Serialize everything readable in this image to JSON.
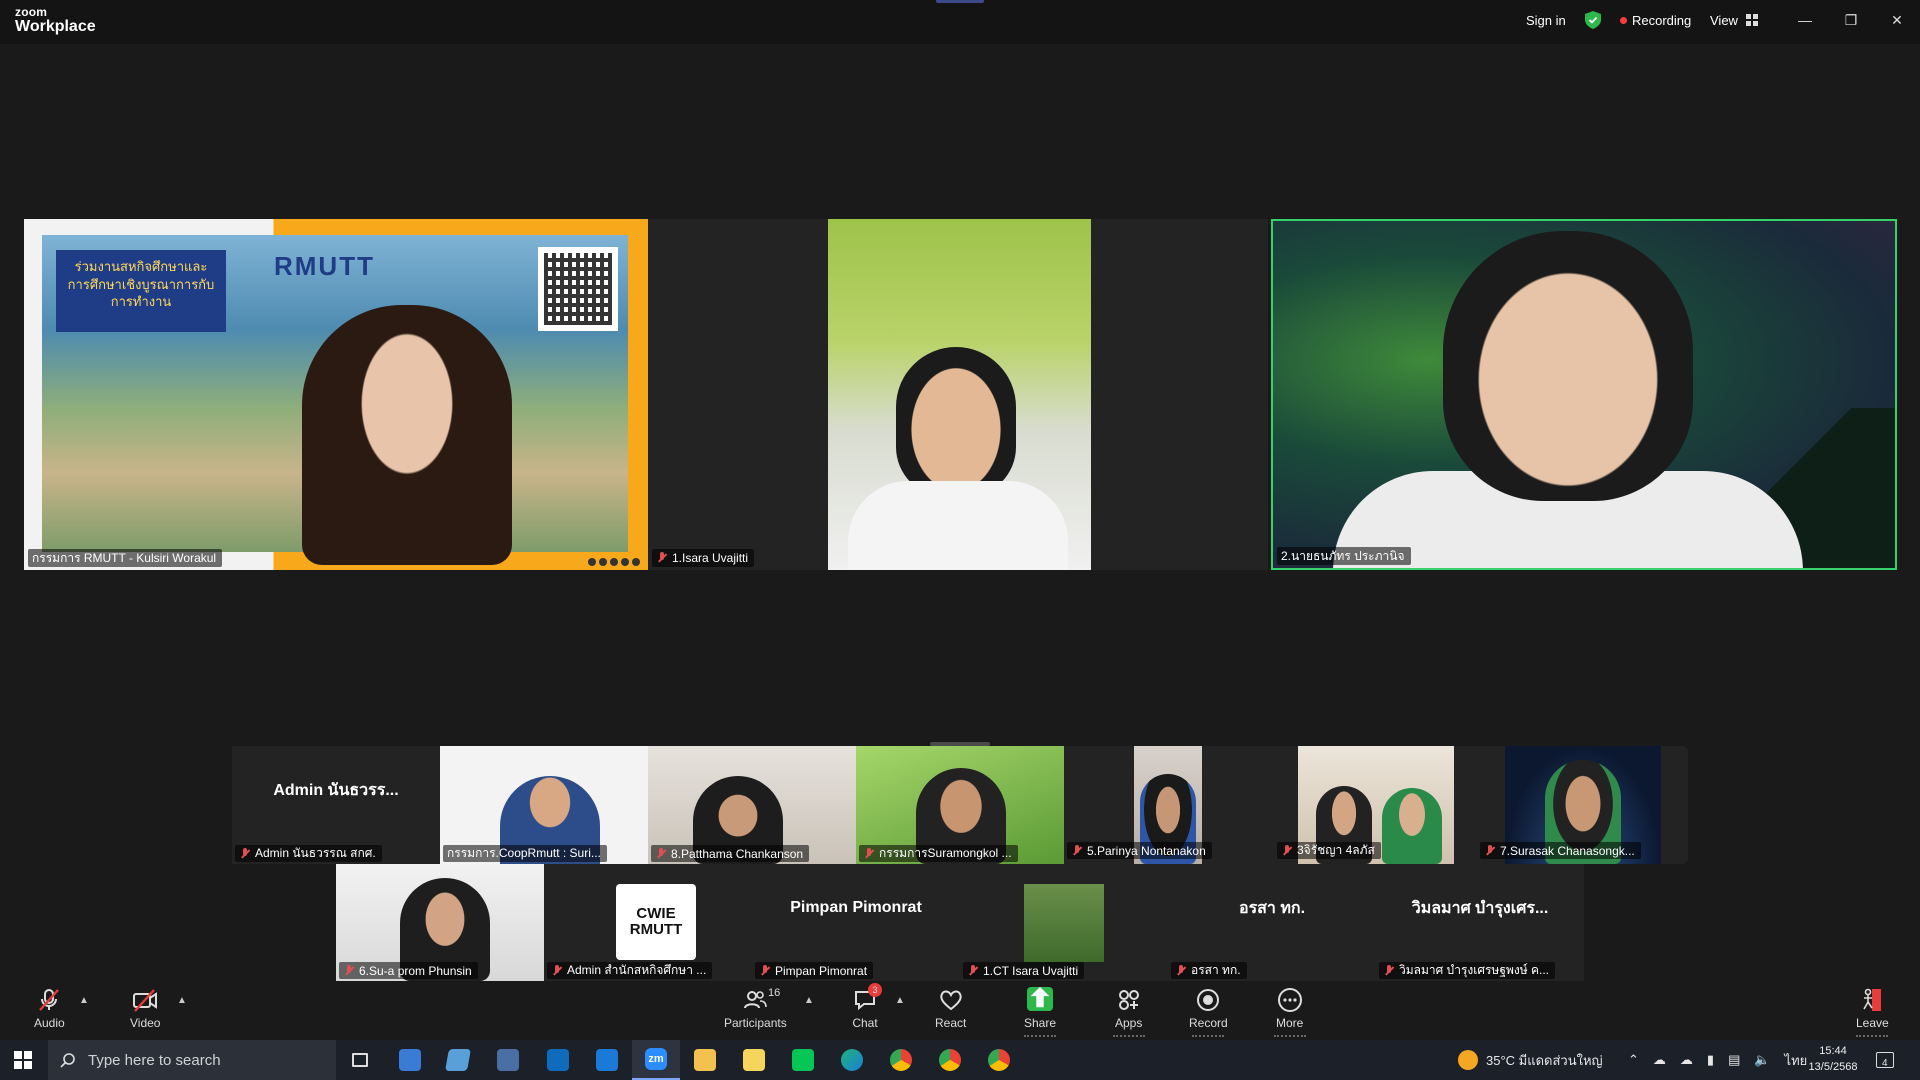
{
  "app": {
    "brand_top": "zoom",
    "brand_bottom": "Workplace"
  },
  "titlebar": {
    "sign_in": "Sign in",
    "recording": "Recording",
    "view": "View",
    "minimize": "—",
    "restore": "❐",
    "close": "✕"
  },
  "main_tiles": [
    {
      "name": "กรรมการ RMUTT - Kulsiri Worakul",
      "muted": false,
      "slide_text": "ร่วมงานสหกิจศึกษาและการศึกษาเชิงบูรณาการกับการทำงาน",
      "slide_logo": "RMUTT"
    },
    {
      "name": "1.Isara Uvajitti",
      "muted": true
    },
    {
      "name": "2.นายธนภัทร ประภานิจ",
      "muted": false,
      "active_speaker": true
    }
  ],
  "gallery_row1": [
    {
      "name": "Admin นันธวรรณ สกศ.",
      "display": "Admin นันธวรร...",
      "video": false
    },
    {
      "name": "กรรมการ.CoopRmutt : Suri...",
      "video": true
    },
    {
      "name": "8.Patthama Chankanson",
      "video": true
    },
    {
      "name": "กรรมการSuramongkol ...",
      "video": true
    },
    {
      "name": "5.Parinya Nontanakon",
      "video": true
    },
    {
      "name": "3จิรัชญา 4ลภัส",
      "video": true
    },
    {
      "name": "7.Surasak Chanasongk...",
      "video": true
    }
  ],
  "gallery_row2": [
    {
      "name": "6.Su-a prom Phunsin",
      "video": true
    },
    {
      "name": "Admin สำนักสหกิจศึกษา ...",
      "video": true,
      "logo_top": "CWIE",
      "logo_bottom": "RMUTT"
    },
    {
      "name": "Pimpan Pimonrat",
      "display": "Pimpan Pimonrat",
      "video": false
    },
    {
      "name": "1.CT Isara Uvajitti",
      "video": true
    },
    {
      "name": "อรสา  ทก.",
      "display": "อรสา  ทก.",
      "video": false
    },
    {
      "name": "วิมลมาศ บำรุงเศรษฐพงษ์ ค...",
      "display": "วิมลมาศ บำรุงเศร...",
      "video": false
    }
  ],
  "toolbar": {
    "audio": "Audio",
    "video": "Video",
    "participants": "Participants",
    "participants_count": "16",
    "chat": "Chat",
    "chat_badge": "3",
    "react": "React",
    "share": "Share",
    "apps": "Apps",
    "record": "Record",
    "more": "More",
    "leave": "Leave"
  },
  "taskbar": {
    "search_placeholder": "Type here to search",
    "weather": "35°C  มีแดดส่วนใหญ่",
    "language": "ไทย",
    "time": "15:44",
    "date": "13/5/2568",
    "notifications": "4"
  },
  "colors": {
    "active_speaker_border": "#35d26a",
    "share_green": "#2db84b",
    "mute_red": "#e05050",
    "badge_red": "#e83b3b"
  }
}
